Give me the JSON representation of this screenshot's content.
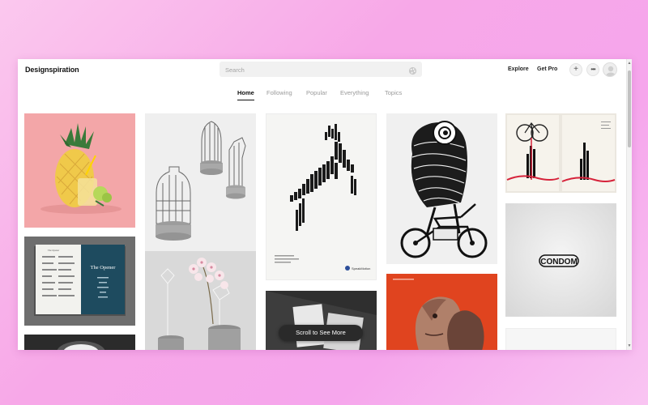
{
  "logo": "Designspiration",
  "search": {
    "placeholder": "Search"
  },
  "header": {
    "explore": "Explore",
    "get_pro": "Get Pro"
  },
  "tabs": [
    {
      "label": "Home",
      "active": true
    },
    {
      "label": "Following",
      "active": false
    },
    {
      "label": "Popular",
      "active": false
    },
    {
      "label": "Everything",
      "active": false
    },
    {
      "label": "Topics",
      "active": false
    }
  ],
  "tiles": {
    "pineapple": {
      "icon": "pineapple-drink-image"
    },
    "book": {
      "left_title": "The Opener",
      "right_title": "The Opener"
    },
    "deer_poster": {
      "brand": "SpeakMotion"
    },
    "condom": {
      "text": "CONDOM"
    }
  },
  "scroll_cta": "Scroll to See More",
  "colors": {
    "background": "#f7a8e8",
    "accent": "#e02030",
    "pill": "#2a2a2a"
  }
}
